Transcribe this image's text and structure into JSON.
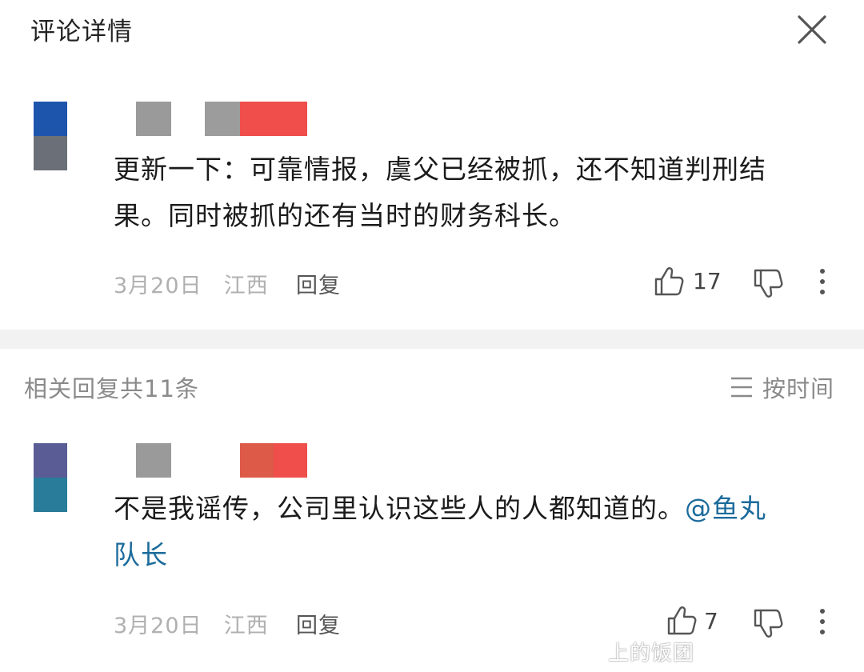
{
  "header": {
    "title": "评论详情"
  },
  "main_comment": {
    "content": "更新一下：可靠情报，虞父已经被抓，还不知道判刑结果。同时被抓的还有当时的财务科长。",
    "line1": "更新一下：可靠情报，虞父已经被抓，还不知道判刑结",
    "line2": "果。同时被抓的还有当时的财务科长。",
    "date": "3月20日",
    "location": "江西",
    "reply_label": "回复",
    "likes": "17"
  },
  "replies_header": {
    "label": "相关回复共11条",
    "sort_label": "按时间"
  },
  "reply_comment": {
    "line1": "不是我谣传，公司里认识这些人的人都知道的。",
    "mention_part1": "@鱼丸",
    "mention_part2": "队长",
    "date": "3月20日",
    "location": "江西",
    "reply_label": "回复",
    "likes": "7"
  },
  "watermark": "上的饭团",
  "colors": {
    "mention": "#1c6b9c",
    "divider": "#f2f2f2",
    "meta_gray": "#b0b0b0",
    "blur_red": "#ef4e4a",
    "blur_gray": "#9a9a9a"
  },
  "icons": [
    "close-icon",
    "thumbs-up-icon",
    "thumbs-down-icon",
    "more-icon",
    "sort-icon"
  ]
}
